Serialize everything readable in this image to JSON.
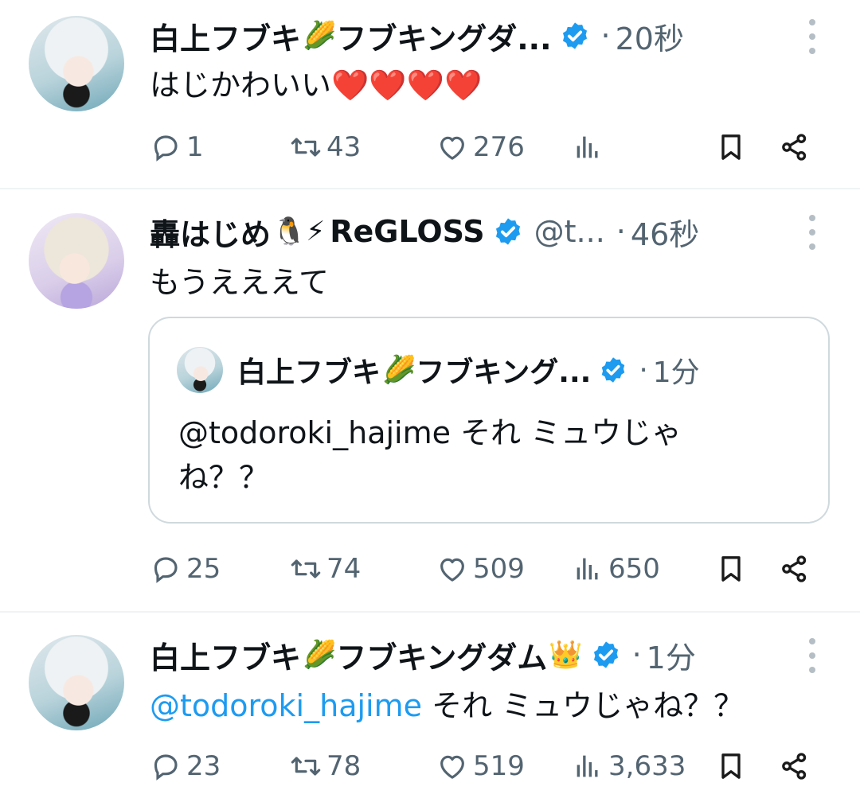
{
  "tweets": [
    {
      "name": "白上フブキ",
      "name_emoji": "🌽",
      "name_suffix": "フブキングダ...",
      "time": "20秒",
      "text": "はじかわいい",
      "text_emoji": "❤️❤️❤️❤️",
      "stats": {
        "replies": "1",
        "retweets": "43",
        "likes": "276",
        "views": ""
      }
    },
    {
      "name": "轟はじめ",
      "name_emoji": "🐧⚡",
      "name_suffix": "ReGLOSS",
      "handle": "@t...",
      "time": "46秒",
      "text": "もうえええて",
      "quote": {
        "name": "白上フブキ",
        "name_emoji": "🌽",
        "name_suffix": "フブキング...",
        "time": "1分",
        "text": "@todoroki_hajime  それ ミュウじゃね？？"
      },
      "stats": {
        "replies": "25",
        "retweets": "74",
        "likes": "509",
        "views": "650"
      }
    },
    {
      "name": "白上フブキ",
      "name_emoji": "🌽",
      "name_suffix": "フブキングダム",
      "name_emoji2": "👑",
      "time": "1分",
      "mention": "@todoroki_hajime",
      "text": " それ ミュウじゃね？？",
      "stats": {
        "replies": "23",
        "retweets": "78",
        "likes": "519",
        "views": "3,633"
      }
    }
  ],
  "icons": {
    "reply": "reply-icon",
    "retweet": "retweet-icon",
    "like": "heart-icon",
    "views": "views-icon",
    "bookmark": "bookmark-icon",
    "share": "share-icon",
    "verified": "verified-badge-icon",
    "more": "more-icon"
  },
  "colors": {
    "verified": "#1d9bf0",
    "muted": "#536471",
    "link": "#1d9bf0",
    "border": "#cfd9de"
  }
}
